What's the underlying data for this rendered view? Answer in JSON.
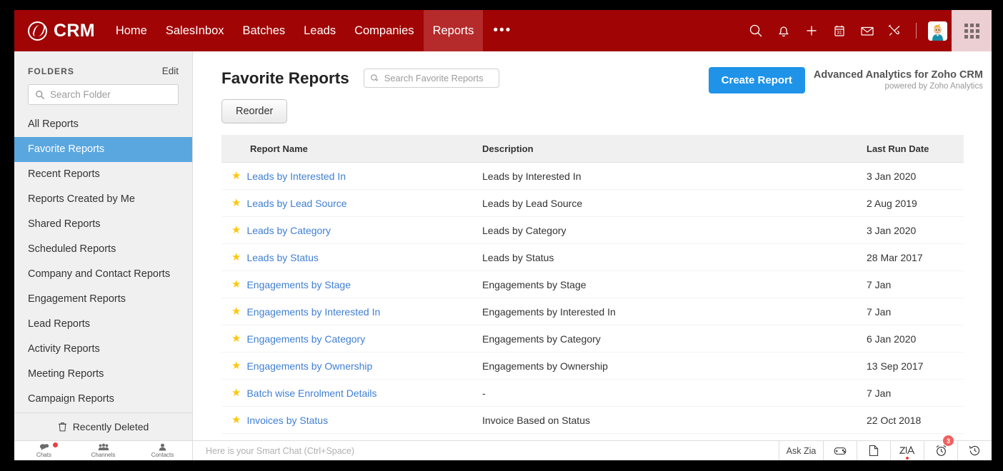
{
  "topnav": {
    "brand": "CRM",
    "items": [
      {
        "label": "Home",
        "active": false
      },
      {
        "label": "SalesInbox",
        "active": false
      },
      {
        "label": "Batches",
        "active": false
      },
      {
        "label": "Leads",
        "active": false
      },
      {
        "label": "Companies",
        "active": false
      },
      {
        "label": "Reports",
        "active": true
      }
    ],
    "more_label": "•••",
    "icons": [
      "search-icon",
      "bell-icon",
      "plus-icon",
      "calendar-icon",
      "envelope-icon",
      "tools-icon"
    ],
    "calendar_day": "31",
    "accent_color": "#a00404",
    "active_tab_color": "#b52a2a",
    "apps_panel_color": "#eccfd2"
  },
  "sidebar": {
    "title": "FOLDERS",
    "edit_label": "Edit",
    "search_placeholder": "Search Folder",
    "search_value": "",
    "items": [
      {
        "label": "All Reports",
        "active": false
      },
      {
        "label": "Favorite Reports",
        "active": true
      },
      {
        "label": "Recent Reports",
        "active": false
      },
      {
        "label": "Reports Created by Me",
        "active": false
      },
      {
        "label": "Shared Reports",
        "active": false
      },
      {
        "label": "Scheduled Reports",
        "active": false
      },
      {
        "label": "Company and Contact Reports",
        "active": false
      },
      {
        "label": "Engagement Reports",
        "active": false
      },
      {
        "label": "Lead Reports",
        "active": false
      },
      {
        "label": "Activity Reports",
        "active": false
      },
      {
        "label": "Meeting Reports",
        "active": false
      },
      {
        "label": "Campaign Reports",
        "active": false
      }
    ],
    "recently_deleted_label": "Recently Deleted",
    "selected_color": "#5aa7e0"
  },
  "main": {
    "page_title": "Favorite Reports",
    "search_placeholder": "Search Favorite Reports",
    "search_value": "",
    "create_report_label": "Create Report",
    "create_report_color": "#1f93e8",
    "advanced_analytics_line1": "Advanced Analytics for Zoho CRM",
    "advanced_analytics_line2": "powered by Zoho Analytics",
    "reorder_label": "Reorder",
    "table": {
      "columns": [
        "Report Name",
        "Description",
        "Last Run Date"
      ],
      "rows": [
        {
          "name": "Leads by Interested In",
          "description": "Leads by Interested In",
          "last_run": "3 Jan 2020",
          "favorite": true
        },
        {
          "name": "Leads by Lead Source",
          "description": "Leads by Lead Source",
          "last_run": "2 Aug 2019",
          "favorite": true
        },
        {
          "name": "Leads by Category",
          "description": "Leads by Category",
          "last_run": "3 Jan 2020",
          "favorite": true
        },
        {
          "name": "Leads by Status",
          "description": "Leads by Status",
          "last_run": "28 Mar 2017",
          "favorite": true
        },
        {
          "name": "Engagements by Stage",
          "description": "Engagements by Stage",
          "last_run": "7 Jan",
          "favorite": true
        },
        {
          "name": "Engagements by Interested In",
          "description": "Engagements by Interested In",
          "last_run": "7 Jan",
          "favorite": true
        },
        {
          "name": "Engagements by Category",
          "description": "Engagements by Category",
          "last_run": "6 Jan 2020",
          "favorite": true
        },
        {
          "name": "Engagements by Ownership",
          "description": "Engagements by Ownership",
          "last_run": "13 Sep 2017",
          "favorite": true
        },
        {
          "name": "Batch wise Enrolment Details",
          "description": "-",
          "last_run": "7 Jan",
          "favorite": true
        },
        {
          "name": "Invoices by Status",
          "description": "Invoice Based on Status",
          "last_run": "22 Oct 2018",
          "favorite": true
        }
      ],
      "star_color": "#fdc70c",
      "link_color": "#3f7fd4"
    }
  },
  "bottombar": {
    "tabs": [
      {
        "label": "Chats",
        "icon": "chat-bubbles-icon",
        "badge": true
      },
      {
        "label": "Channels",
        "icon": "channels-people-icon",
        "badge": false
      },
      {
        "label": "Contacts",
        "icon": "contact-person-icon",
        "badge": false
      }
    ],
    "smart_chat_placeholder": "Here is your Smart Chat (Ctrl+Space)",
    "smart_chat_value": "",
    "ask_zia_label": "Ask Zia",
    "actions": [
      "game-controller-icon",
      "note-icon",
      "zia-icon",
      "alarm-clock-icon",
      "history-clock-icon"
    ],
    "alarm_badge_count": "3",
    "badge_color": "#f16060"
  }
}
